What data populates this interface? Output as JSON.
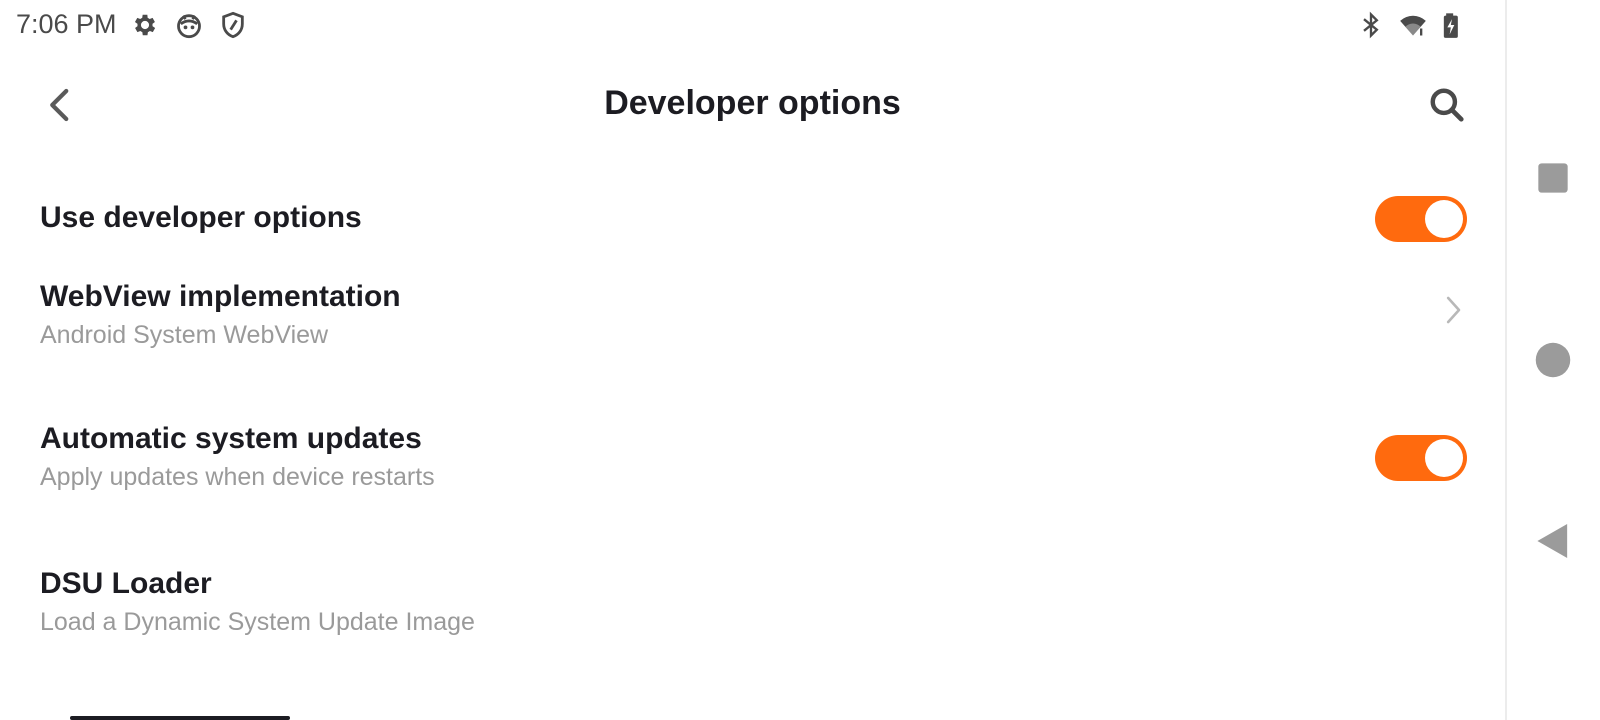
{
  "status_bar": {
    "time": "7:06 PM",
    "left_icons": [
      "gear-icon",
      "robot-face-icon",
      "shield-icon"
    ],
    "right_icons": [
      "bluetooth-icon",
      "wifi-icon",
      "battery-charging-icon"
    ]
  },
  "header": {
    "title": "Developer options",
    "back_icon": "chevron-left-icon",
    "search_icon": "search-icon"
  },
  "rows": [
    {
      "title": "Use developer options",
      "subtitle": "",
      "control": "toggle",
      "on": true
    },
    {
      "title": "WebView implementation",
      "subtitle": "Android System WebView",
      "control": "chevron"
    },
    {
      "title": "Automatic system updates",
      "subtitle": "Apply updates when device restarts",
      "control": "toggle",
      "on": true
    },
    {
      "title": "DSU Loader",
      "subtitle": "Load a Dynamic System Update Image",
      "control": "none"
    }
  ],
  "navigation_bar": {
    "buttons": [
      "recents-square-icon",
      "home-circle-icon",
      "back-triangle-icon"
    ]
  },
  "colors": {
    "accent": "#FF6A0E",
    "title_text": "#1C1C22",
    "subtitle_text": "#9A9A9A",
    "icon_gray": "#5A5A5A",
    "nav_icon_gray": "#9B9B9B"
  }
}
